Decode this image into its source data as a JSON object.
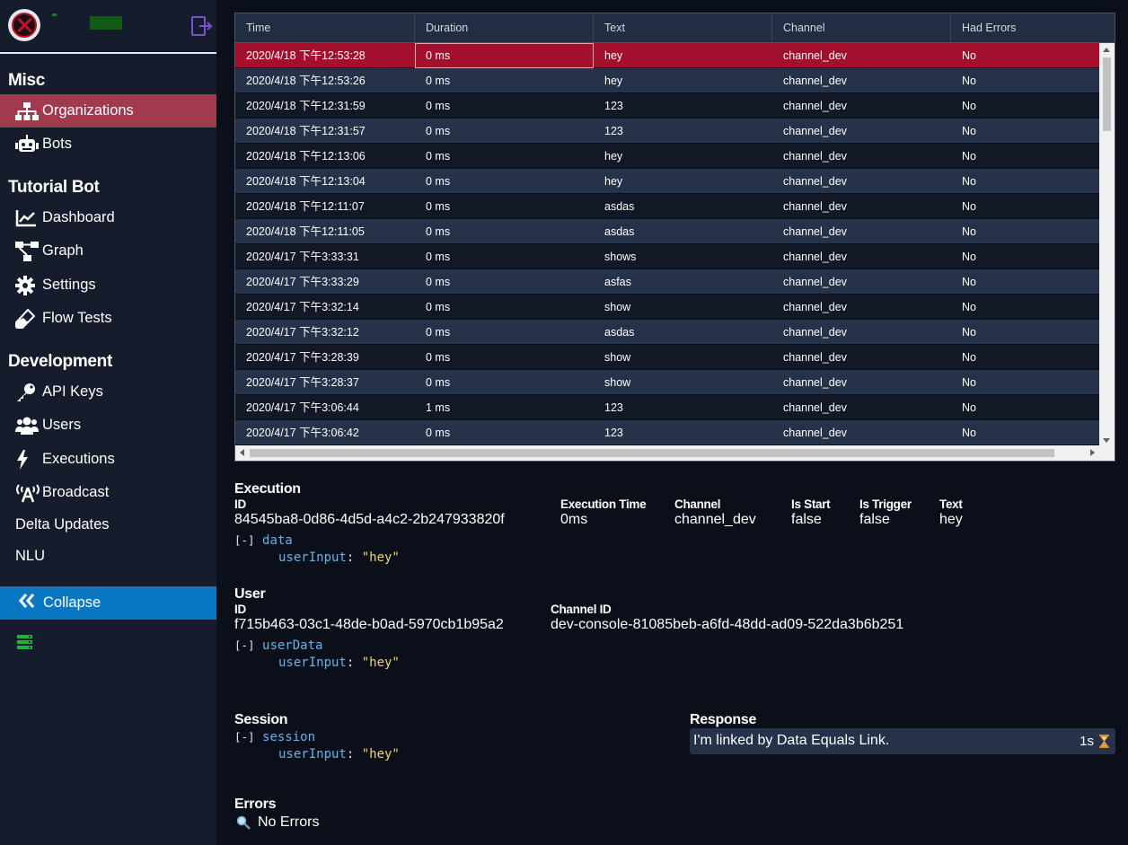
{
  "sidebar": {
    "sections": {
      "misc": "Misc",
      "tutorial_bot": "Tutorial Bot",
      "development": "Development"
    },
    "items": {
      "organizations": "Organizations",
      "bots": "Bots",
      "dashboard": "Dashboard",
      "graph": "Graph",
      "settings": "Settings",
      "flow_tests": "Flow Tests",
      "api_keys": "API Keys",
      "users": "Users",
      "executions": "Executions",
      "broadcast": "Broadcast",
      "delta_updates": "Delta Updates",
      "nlu": "NLU"
    },
    "collapse": "Collapse",
    "active_item": "organizations"
  },
  "table": {
    "columns": [
      "Time",
      "Duration",
      "Text",
      "Channel",
      "Had Errors"
    ],
    "rows": [
      [
        "2020/4/18 下午12:53:28",
        "0 ms",
        "hey",
        "channel_dev",
        "No"
      ],
      [
        "2020/4/18 下午12:53:26",
        "0 ms",
        "hey",
        "channel_dev",
        "No"
      ],
      [
        "2020/4/18 下午12:31:59",
        "0 ms",
        "123",
        "channel_dev",
        "No"
      ],
      [
        "2020/4/18 下午12:31:57",
        "0 ms",
        "123",
        "channel_dev",
        "No"
      ],
      [
        "2020/4/18 下午12:13:06",
        "0 ms",
        "hey",
        "channel_dev",
        "No"
      ],
      [
        "2020/4/18 下午12:13:04",
        "0 ms",
        "hey",
        "channel_dev",
        "No"
      ],
      [
        "2020/4/18 下午12:11:07",
        "0 ms",
        "asdas",
        "channel_dev",
        "No"
      ],
      [
        "2020/4/18 下午12:11:05",
        "0 ms",
        "asdas",
        "channel_dev",
        "No"
      ],
      [
        "2020/4/17 下午3:33:31",
        "0 ms",
        "shows",
        "channel_dev",
        "No"
      ],
      [
        "2020/4/17 下午3:33:29",
        "0 ms",
        "asfas",
        "channel_dev",
        "No"
      ],
      [
        "2020/4/17 下午3:32:14",
        "0 ms",
        "show",
        "channel_dev",
        "No"
      ],
      [
        "2020/4/17 下午3:32:12",
        "0 ms",
        "asdas",
        "channel_dev",
        "No"
      ],
      [
        "2020/4/17 下午3:28:39",
        "0 ms",
        "show",
        "channel_dev",
        "No"
      ],
      [
        "2020/4/17 下午3:28:37",
        "0 ms",
        "show",
        "channel_dev",
        "No"
      ],
      [
        "2020/4/17 下午3:06:44",
        "1 ms",
        "123",
        "channel_dev",
        "No"
      ],
      [
        "2020/4/17 下午3:06:42",
        "0 ms",
        "123",
        "channel_dev",
        "No"
      ]
    ],
    "selected_row": 0
  },
  "execution": {
    "title": "Execution",
    "id_label": "ID",
    "id_value": "84545ba8-0d86-4d5d-a4c2-2b247933820f",
    "exec_time_label": "Execution Time",
    "exec_time_value": "0ms",
    "channel_label": "Channel",
    "channel_value": "channel_dev",
    "is_start_label": "Is Start",
    "is_start_value": "false",
    "is_trigger_label": "Is Trigger",
    "is_trigger_value": "false",
    "text_label": "Text",
    "text_value": "hey",
    "tree": {
      "toggle": "[-]",
      "root": "data",
      "key": "userInput",
      "value": "\"hey\""
    }
  },
  "user": {
    "title": "User",
    "id_label": "ID",
    "id_value": "f715b463-03c1-48de-b0ad-5970cb1b95a2",
    "channel_id_label": "Channel ID",
    "channel_id_value": "dev-console-81085beb-a6fd-48dd-ad09-522da3b6b251",
    "tree": {
      "toggle": "[-]",
      "root": "userData",
      "key": "userInput",
      "value": "\"hey\""
    }
  },
  "session": {
    "title": "Session",
    "tree": {
      "toggle": "[-]",
      "root": "session",
      "key": "userInput",
      "value": "\"hey\""
    }
  },
  "response": {
    "title": "Response",
    "text": "I'm linked by Data Equals Link.",
    "time": "1s"
  },
  "errors": {
    "title": "Errors",
    "text": "No Errors"
  },
  "colors": {
    "sidebar_bg": "#151c2b",
    "active_item": "#a23a4f",
    "collapse_bg": "#0a77c2",
    "selected_row": "#a3102d",
    "json_key": "#63b3ed",
    "json_string": "#f1d56b"
  }
}
